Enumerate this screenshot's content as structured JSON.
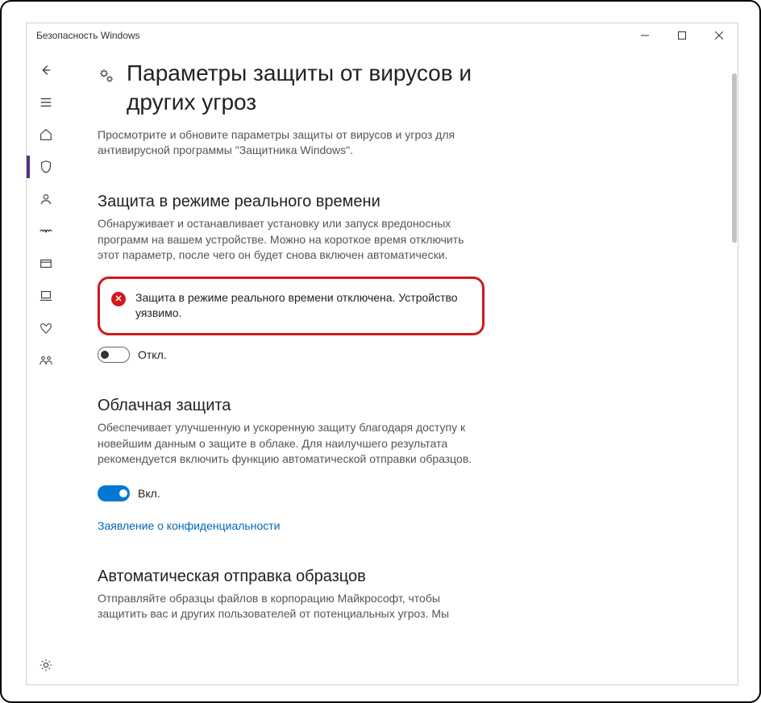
{
  "window": {
    "title": "Безопасность Windows"
  },
  "page": {
    "title": "Параметры защиты от вирусов и других угроз",
    "desc": "Просмотрите и обновите параметры защиты от вирусов и угроз для антивирусной программы \"Защитника Windows\"."
  },
  "realtime": {
    "title": "Защита в режиме реального времени",
    "desc": "Обнаруживает и останавливает установку или запуск вредоносных программ на вашем устройстве. Можно на короткое время отключить этот параметр, после чего он будет снова включен автоматически.",
    "alert": "Защита в режиме реального времени отключена. Устройство уязвимо.",
    "toggle_label": "Откл."
  },
  "cloud": {
    "title": "Облачная защита",
    "desc": "Обеспечивает улучшенную и ускоренную защиту благодаря доступу к новейшим данным о защите в облаке. Для наилучшего результата рекомендуется включить функцию автоматической отправки образцов.",
    "toggle_label": "Вкл.",
    "privacy_link": "Заявление о конфиденциальности"
  },
  "auto_submit": {
    "title": "Автоматическая отправка образцов",
    "desc": "Отправляйте образцы файлов в корпорацию Майкрософт, чтобы защитить вас и других пользователей от потенциальных угроз. Мы"
  }
}
